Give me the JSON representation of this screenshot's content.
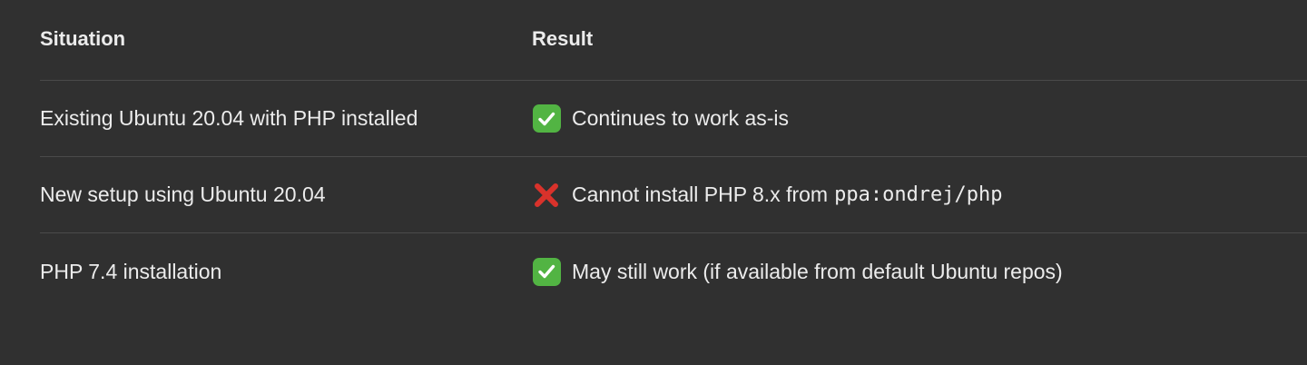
{
  "table": {
    "headers": {
      "situation": "Situation",
      "result": "Result"
    },
    "rows": [
      {
        "situation": "Existing Ubuntu 20.04 with PHP installed",
        "status_icon": "check-mark-icon",
        "status_color": "#52b443",
        "result": "Continues to work as-is",
        "result_code": ""
      },
      {
        "situation": "New setup using Ubuntu 20.04",
        "status_icon": "cross-mark-icon",
        "status_color": "#d9322b",
        "result": "Cannot install PHP 8.x from",
        "result_code": "ppa:ondrej/php"
      },
      {
        "situation": "PHP 7.4 installation",
        "status_icon": "check-mark-icon",
        "status_color": "#52b443",
        "result": "May still work (if available from default Ubuntu repos)",
        "result_code": ""
      }
    ]
  }
}
